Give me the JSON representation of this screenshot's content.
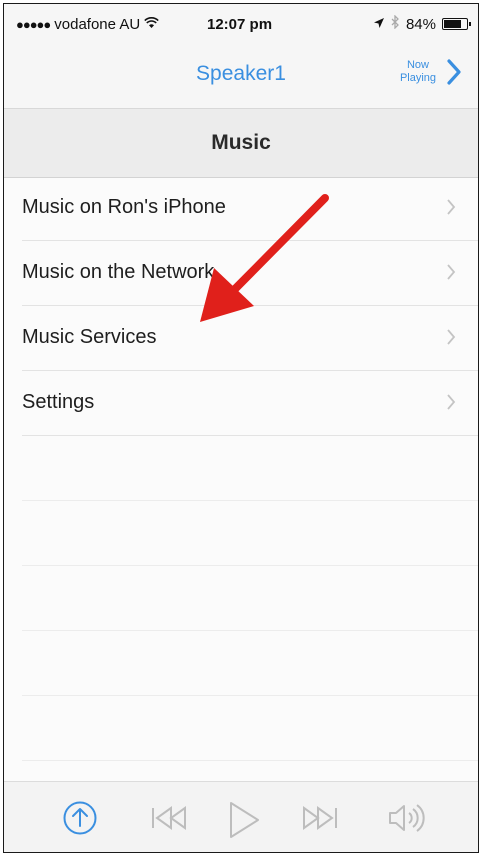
{
  "status_bar": {
    "signal": "●●●●●",
    "carrier": "vodafone AU",
    "time": "12:07 pm",
    "battery": "84%",
    "battery_level": 0.84
  },
  "nav": {
    "title": "Speaker1",
    "now_playing_line1": "Now",
    "now_playing_line2": "Playing"
  },
  "section": {
    "title": "Music"
  },
  "menu": {
    "items": [
      {
        "label": "Music on Ron's iPhone"
      },
      {
        "label": "Music on the Network"
      },
      {
        "label": "Music Services"
      },
      {
        "label": "Settings"
      }
    ]
  },
  "colors": {
    "accent": "#3a8fe0",
    "annotation_arrow": "#e0201b"
  },
  "toolbar": {
    "icons": [
      "upload-icon",
      "previous-icon",
      "play-icon",
      "next-icon",
      "volume-icon"
    ]
  }
}
